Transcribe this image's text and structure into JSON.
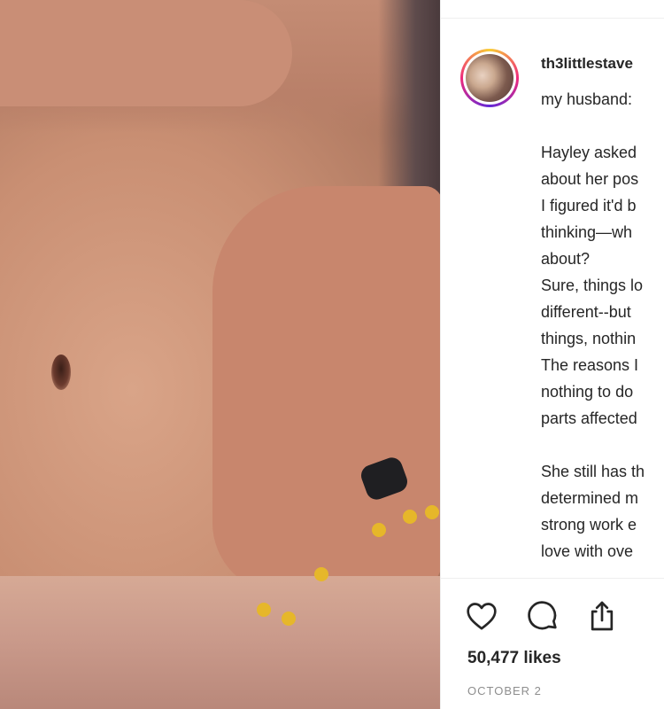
{
  "post": {
    "username": "th3littlestave",
    "caption_lines": [
      "my husband:",
      "",
      "Hayley asked",
      "about her pos",
      "I figured it'd b",
      "thinking—wh",
      "about?",
      "Sure, things lo",
      "different--but",
      "things, nothin",
      "The reasons I",
      "nothing to do",
      "parts affected",
      "",
      "She still has th",
      "determined m",
      "strong work e",
      "love with ove"
    ],
    "likes": "50,477 likes",
    "date": "OCTOBER 2"
  },
  "actions": {
    "like_icon": "heart-icon",
    "comment_icon": "comment-icon",
    "share_icon": "share-icon"
  },
  "colors": {
    "text": "#262626",
    "muted": "#8e8e8e",
    "divider": "#efefef"
  }
}
